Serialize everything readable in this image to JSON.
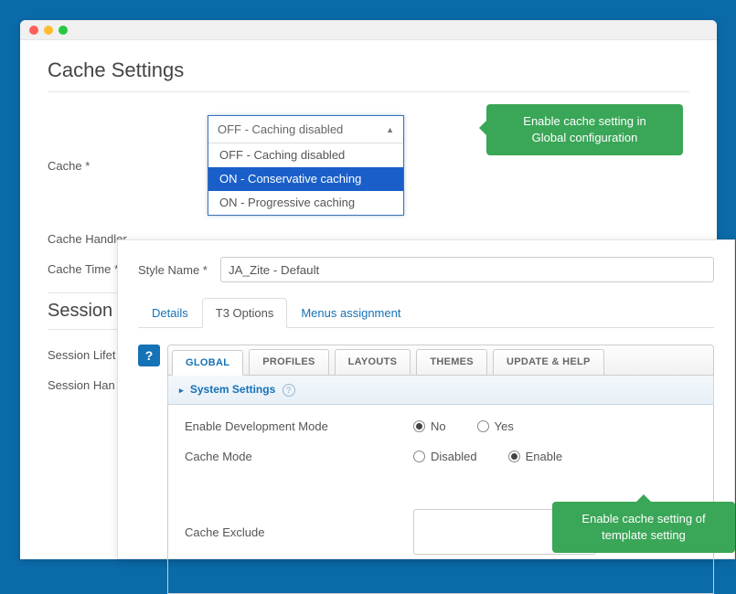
{
  "page": {
    "title": "Cache Settings",
    "section2_title": "Session"
  },
  "fields": {
    "cache_label": "Cache *",
    "cache_handler_label": "Cache Handler",
    "cache_time_label": "Cache Time *",
    "session_lifetime_label": "Session Lifet",
    "session_handler_label": "Session Han"
  },
  "dropdown": {
    "selected": "OFF - Caching disabled",
    "options": {
      "0": "OFF - Caching disabled",
      "1": "ON - Conservative caching",
      "2": "ON - Progressive caching"
    }
  },
  "tooltip1": {
    "line1": "Enable cache setting in",
    "line2": "Global configuration"
  },
  "panel2": {
    "style_name_label": "Style Name *",
    "style_name_value": "JA_Zite - Default",
    "tabs": {
      "0": "Details",
      "1": "T3 Options",
      "2": "Menus assignment"
    },
    "inner_tabs": {
      "0": "GLOBAL",
      "1": "PROFILES",
      "2": "LAYOUTS",
      "3": "THEMES",
      "4": "UPDATE & HELP"
    },
    "subhead": "System Settings",
    "options": {
      "dev_mode_label": "Enable Development Mode",
      "dev_mode_no": "No",
      "dev_mode_yes": "Yes",
      "cache_mode_label": "Cache Mode",
      "cache_mode_disabled": "Disabled",
      "cache_mode_enable": "Enable",
      "cache_exclude_label": "Cache Exclude"
    }
  },
  "tooltip2": {
    "line1": "Enable cache setting of",
    "line2": "template setting"
  }
}
